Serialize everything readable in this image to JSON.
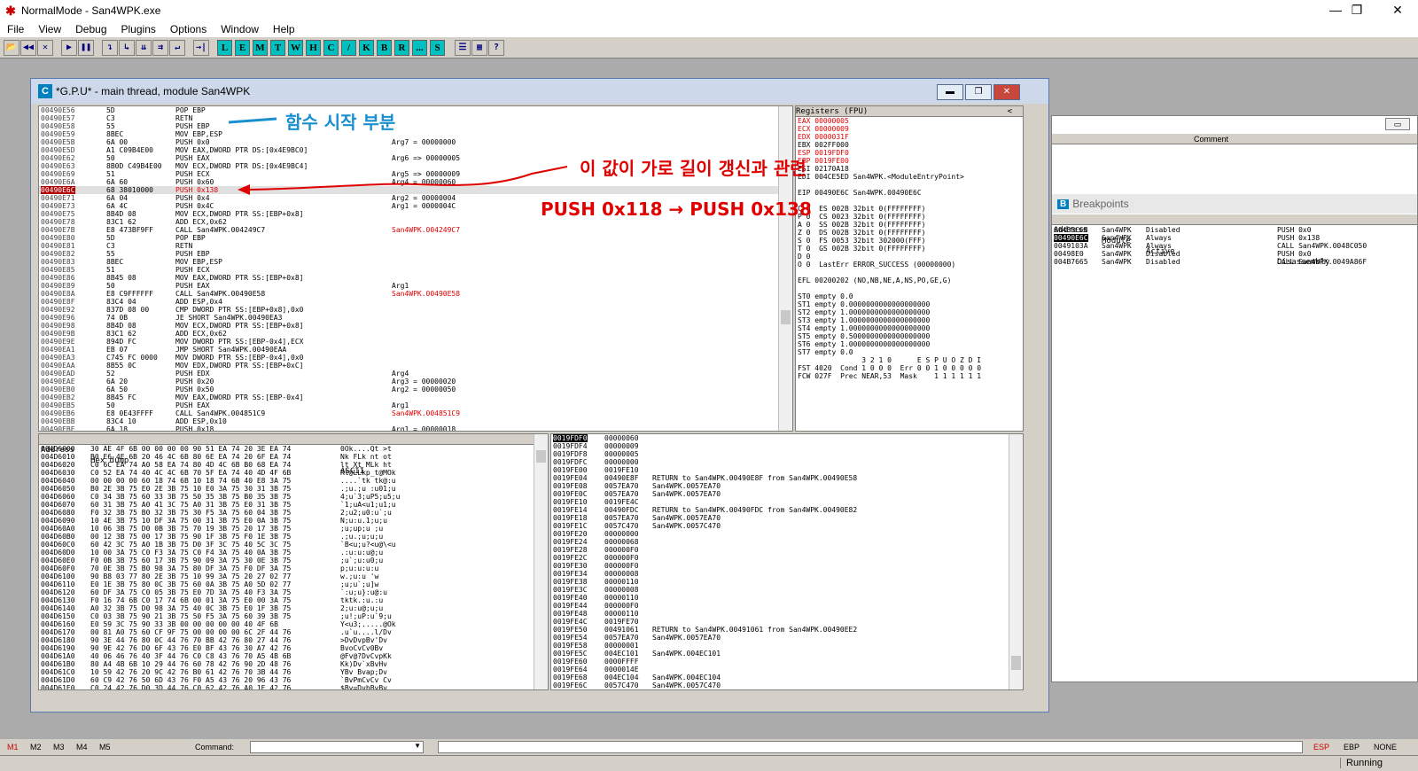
{
  "window": {
    "title": "NormalMode - San4WPK.exe",
    "minimize": "—",
    "maximize": "❐",
    "close": "✕"
  },
  "menu": [
    "File",
    "View",
    "Debug",
    "Plugins",
    "Options",
    "Window",
    "Help"
  ],
  "toolbar": {
    "buttons": [
      "📂",
      "◀◀",
      "✕",
      "▶",
      "❚❚",
      "↴",
      "↳",
      "⇊",
      "⇉",
      "↵",
      "→|"
    ],
    "letters": [
      "L",
      "E",
      "M",
      "T",
      "W",
      "H",
      "C",
      "/",
      "K",
      "B",
      "R",
      "...",
      "S"
    ],
    "extras": [
      "☰",
      "▦",
      "?"
    ]
  },
  "cpu": {
    "title": "*G.P.U* - main thread, module San4WPK",
    "icon": "C"
  },
  "disasm": {
    "rows": [
      {
        "a": "00490E56",
        "h": "5D",
        "c": "POP EBP",
        "m": ""
      },
      {
        "a": "00490E57",
        "h": "C3",
        "c": "RETN",
        "m": ""
      },
      {
        "a": "00490E58",
        "h": "55",
        "c": "PUSH EBP",
        "m": ""
      },
      {
        "a": "00490E59",
        "h": "8BEC",
        "c": "MOV EBP,ESP",
        "m": ""
      },
      {
        "a": "00490E5B",
        "h": "6A 00",
        "c": "PUSH 0x0",
        "m": "Arg7 = 00000000"
      },
      {
        "a": "00490E5D",
        "h": "A1 C09B4E00",
        "c": "MOV EAX,DWORD PTR DS:[0x4E9BC0]",
        "m": ""
      },
      {
        "a": "00490E62",
        "h": "50",
        "c": "PUSH EAX",
        "m": "Arg6 => 00000005"
      },
      {
        "a": "00490E63",
        "h": "8B0D C49B4E00",
        "c": "MOV ECX,DWORD PTR DS:[0x4E9BC4]",
        "m": ""
      },
      {
        "a": "00490E69",
        "h": "51",
        "c": "PUSH ECX",
        "m": "Arg5 => 00000009"
      },
      {
        "a": "00490E6A",
        "h": "6A 60",
        "c": "PUSH 0x60",
        "m": "Arg4 = 00000060"
      },
      {
        "a": "00490E6C",
        "h": "68 38010000",
        "c": "PUSH 0x138",
        "m": "",
        "hl": true
      },
      {
        "a": "00490E71",
        "h": "6A 04",
        "c": "PUSH 0x4",
        "m": "Arg2 = 00000004"
      },
      {
        "a": "00490E73",
        "h": "6A 4C",
        "c": "PUSH 0x4C",
        "m": "Arg1 = 0000004C"
      },
      {
        "a": "00490E75",
        "h": "8B4D 08",
        "c": "MOV ECX,DWORD PTR SS:[EBP+0x8]",
        "m": ""
      },
      {
        "a": "00490E78",
        "h": "83C1 62",
        "c": "ADD ECX,0x62",
        "m": ""
      },
      {
        "a": "00490E7B",
        "h": "E8 473BF9FF",
        "c": "CALL San4WPK.004249C7",
        "m": "San4WPK.004249C7"
      },
      {
        "a": "00490E80",
        "h": "5D",
        "c": "POP EBP",
        "m": ""
      },
      {
        "a": "00490E81",
        "h": "C3",
        "c": "RETN",
        "m": ""
      },
      {
        "a": "00490E82",
        "h": "55",
        "c": "PUSH EBP",
        "m": ""
      },
      {
        "a": "00490E83",
        "h": "8BEC",
        "c": "MOV EBP,ESP",
        "m": ""
      },
      {
        "a": "00490E85",
        "h": "51",
        "c": "PUSH ECX",
        "m": ""
      },
      {
        "a": "00490E86",
        "h": "8B45 08",
        "c": "MOV EAX,DWORD PTR SS:[EBP+0x8]",
        "m": ""
      },
      {
        "a": "00490E89",
        "h": "50",
        "c": "PUSH EAX",
        "m": "Arg1"
      },
      {
        "a": "00490E8A",
        "h": "E8 C9FFFFFF",
        "c": "CALL San4WPK.00490E58",
        "m": "San4WPK.00490E58"
      },
      {
        "a": "00490E8F",
        "h": "83C4 04",
        "c": "ADD ESP,0x4",
        "m": ""
      },
      {
        "a": "00490E92",
        "h": "837D 08 00",
        "c": "CMP DWORD PTR SS:[EBP+0x8],0x0",
        "m": ""
      },
      {
        "a": "00490E96",
        "h": "74 0B",
        "c": "JE SHORT San4WPK.00490EA3",
        "m": ""
      },
      {
        "a": "00490E98",
        "h": "8B4D 08",
        "c": "MOV ECX,DWORD PTR SS:[EBP+0x8]",
        "m": ""
      },
      {
        "a": "00490E9B",
        "h": "83C1 62",
        "c": "ADD ECX,0x62",
        "m": ""
      },
      {
        "a": "00490E9E",
        "h": "894D FC",
        "c": "MOV DWORD PTR SS:[EBP-0x4],ECX",
        "m": ""
      },
      {
        "a": "00490EA1",
        "h": "EB 07",
        "c": "JMP SHORT San4WPK.00490EAA",
        "m": ""
      },
      {
        "a": "00490EA3",
        "h": "C745 FC 0000",
        "c": "MOV DWORD PTR SS:[EBP-0x4],0x0",
        "m": ""
      },
      {
        "a": "00490EAA",
        "h": "8B55 0C",
        "c": "MOV EDX,DWORD PTR SS:[EBP+0xC]",
        "m": ""
      },
      {
        "a": "00490EAD",
        "h": "52",
        "c": "PUSH EDX",
        "m": "Arg4"
      },
      {
        "a": "00490EAE",
        "h": "6A 20",
        "c": "PUSH 0x20",
        "m": "Arg3 = 00000020"
      },
      {
        "a": "00490EB0",
        "h": "6A 50",
        "c": "PUSH 0x50",
        "m": "Arg2 = 00000050"
      },
      {
        "a": "00490EB2",
        "h": "8B45 FC",
        "c": "MOV EAX,DWORD PTR SS:[EBP-0x4]",
        "m": ""
      },
      {
        "a": "00490EB5",
        "h": "50",
        "c": "PUSH EAX",
        "m": "Arg1"
      },
      {
        "a": "00490EB6",
        "h": "E8 0E43FFFF",
        "c": "CALL San4WPK.004851C9",
        "m": "San4WPK.004851C9"
      },
      {
        "a": "00490EBB",
        "h": "83C4 10",
        "c": "ADD ESP,0x10",
        "m": ""
      },
      {
        "a": "00490EBE",
        "h": "6A 18",
        "c": "PUSH 0x18",
        "m": "Arg1 = 00000018"
      }
    ]
  },
  "registers": {
    "title": "Registers (FPU)",
    "rows": [
      {
        "t": "EAX 00000005",
        "red": true
      },
      {
        "t": "ECX 00000009",
        "red": true
      },
      {
        "t": "EDX 0000031F",
        "red": true
      },
      {
        "t": "EBX 002FF000"
      },
      {
        "t": "ESP 0019FDF0",
        "red": true
      },
      {
        "t": "EBP 0019FE00",
        "red": true
      },
      {
        "t": "ESI 02170A18"
      },
      {
        "t": "EDI 004CE5ED San4WPK.<ModuleEntryPoint>"
      },
      {
        "t": ""
      },
      {
        "t": "EIP 00490E6C San4WPK.00490E6C"
      },
      {
        "t": ""
      },
      {
        "t": "C 0  ES 002B 32bit 0(FFFFFFFF)"
      },
      {
        "t": "P 0  CS 0023 32bit 0(FFFFFFFF)"
      },
      {
        "t": "A 0  SS 002B 32bit 0(FFFFFFFF)"
      },
      {
        "t": "Z 0  DS 002B 32bit 0(FFFFFFFF)"
      },
      {
        "t": "S 0  FS 0053 32bit 302000(FFF)"
      },
      {
        "t": "T 0  GS 002B 32bit 0(FFFFFFFF)"
      },
      {
        "t": "D 0"
      },
      {
        "t": "O 0  LastErr ERROR_SUCCESS (00000000)"
      },
      {
        "t": ""
      },
      {
        "t": "EFL 00200202 (NO,NB,NE,A,NS,PO,GE,G)"
      },
      {
        "t": ""
      },
      {
        "t": "ST0 empty 0.0"
      },
      {
        "t": "ST1 empty 0.0000000000000000000"
      },
      {
        "t": "ST2 empty 1.0000000000000000000"
      },
      {
        "t": "ST3 empty 1.0000000000000000000"
      },
      {
        "t": "ST4 empty 1.0000000000000000000"
      },
      {
        "t": "ST5 empty 0.5000000000000000000"
      },
      {
        "t": "ST6 empty 1.0000000000000000000"
      },
      {
        "t": "ST7 empty 0.0"
      },
      {
        "t": "               3 2 1 0      E S P U O Z D I"
      },
      {
        "t": "FST 4020  Cond 1 0 0 0  Err 0 0 1 0 0 0 0 0"
      },
      {
        "t": "FCW 027F  Prec NEAR,53  Mask    1 1 1 1 1 1"
      }
    ]
  },
  "dump": {
    "headers": [
      "Address",
      "Hex dump",
      "ASCII"
    ],
    "rows": [
      {
        "a": "004D6000",
        "h": "30 AE 4F 6B 00 00 00 00 90 51 EA 74 20 3E EA 74",
        "s": "0Ok....Qt >t"
      },
      {
        "a": "004D6010",
        "h": "B0 E6 4E 6B 20 46 4C 6B 80 6E EA 74 20 6F EA 74",
        "s": "Nk FLk nt ot"
      },
      {
        "a": "004D6020",
        "h": "C0 6C EA 74 A0 58 EA 74 80 4D 4C 6B B0 68 EA 74",
        "s": "lt Xt MLk ht"
      },
      {
        "a": "004D6030",
        "h": "C0 52 EA 74 40 4C 4C 6B 70 5F EA 74 40 4D 4F 6B",
        "s": "Rt@LLkp_t@MOk"
      },
      {
        "a": "004D6040",
        "h": "00 00 00 00 60 18 74 6B 10 18 74 6B 40 E8 3A 75",
        "s": "....`tk tk@:u"
      },
      {
        "a": "004D6050",
        "h": "B0 2E 3B 75 E0 2E 3B 75 10 E0 3A 75 30 31 3B 75",
        "s": ".;u.;u :u01;u"
      },
      {
        "a": "004D6060",
        "h": "C0 34 3B 75 60 33 3B 75 50 35 3B 75 B0 35 3B 75",
        "s": "4;u`3;uP5;u5;u"
      },
      {
        "a": "004D6070",
        "h": "60 31 3B 75 A0 41 3C 75 A0 31 3B 75 E0 31 3B 75",
        "s": "`1;uA<u1;u1;u"
      },
      {
        "a": "004D6080",
        "h": "F0 32 3B 75 B0 32 3B 75 30 F5 3A 75 60 04 3B 75",
        "s": "2;u2;u0:u`;u"
      },
      {
        "a": "004D6090",
        "h": "10 4E 3B 75 10 DF 3A 75 00 31 3B 75 E0 0A 3B 75",
        "s": "N;u:u.1;u;u"
      },
      {
        "a": "004D60A0",
        "h": "10 06 3B 75 D0 0B 3B 75 70 19 3B 75 20 17 3B 75",
        "s": ";u;up;u ;u"
      },
      {
        "a": "004D60B0",
        "h": "00 12 3B 75 00 17 3B 75 90 1F 3B 75 F0 1E 3B 75",
        "s": ".;u.;u;u;u"
      },
      {
        "a": "004D60C0",
        "h": "60 42 3C 75 A0 1B 3B 75 D0 3F 3C 75 40 5C 3C 75",
        "s": "`B<u;u?<u@\\<u"
      },
      {
        "a": "004D60D0",
        "h": "10 00 3A 75 C0 F3 3A 75 C0 F4 3A 75 40 0A 3B 75",
        "s": ".:u:u:u@;u"
      },
      {
        "a": "004D60E0",
        "h": "F0 0B 3B 75 60 17 3B 75 90 09 3A 75 30 0E 3B 75",
        "s": ";u`;u:u0;u"
      },
      {
        "a": "004D60F0",
        "h": "70 0E 3B 75 B0 98 3A 75 80 DF 3A 75 F0 DF 3A 75",
        "s": "p;u:u:u:u"
      },
      {
        "a": "004D6100",
        "h": "90 B8 03 77 80 2E 3B 75 10 99 3A 75 20 27 02 77",
        "s": "w.;u:u 'w"
      },
      {
        "a": "004D6110",
        "h": "E0 1E 3B 75 80 0C 3B 75 60 0A 3B 75 A0 5D 02 77",
        "s": ";u;u`;u]w"
      },
      {
        "a": "004D6120",
        "h": "60 DF 3A 75 C0 05 3B 75 E0 7D 3A 75 40 F3 3A 75",
        "s": "`:u;u}:u@:u"
      },
      {
        "a": "004D6130",
        "h": "F0 16 74 6B C0 17 74 6B 00 01 3A 75 E0 00 3A 75",
        "s": "tktk.:u.:u"
      },
      {
        "a": "004D6140",
        "h": "A0 32 3B 75 D0 98 3A 75 40 0C 3B 75 E0 1F 3B 75",
        "s": "2;u:u@;u;u"
      },
      {
        "a": "004D6150",
        "h": "C0 03 3B 75 90 21 3B 75 50 F5 3A 75 60 39 3B 75",
        "s": ";u!;uP:u`9;u"
      },
      {
        "a": "004D6160",
        "h": "E0 59 3C 75 90 33 3B 00 00 00 00 00 40 4F 6B",
        "s": "Y<u3;.....@Ok"
      },
      {
        "a": "004D6170",
        "h": "00 81 A0 75 60 CF 9F 75 00 00 00 00 6C 2F 44 76",
        "s": ".u`u....l/Dv"
      },
      {
        "a": "004D6180",
        "h": "90 3E 44 76 80 0C 44 76 70 BB 42 76 80 27 44 76",
        "s": ">DvDvpBv'Dv"
      },
      {
        "a": "004D6190",
        "h": "90 9E 42 76 D0 6F 43 76 E0 BF 43 76 30 A7 42 76",
        "s": "BvoCvCv0Bv"
      },
      {
        "a": "004D61A0",
        "h": "40 06 46 76 40 3F 44 76 C0 C8 43 76 70 A5 4B 6B",
        "s": "@Fv@?DvCvpKk"
      },
      {
        "a": "004D61B0",
        "h": "80 A4 4B 6B 10 29 44 76 60 78 42 76 90 2D 48 76",
        "s": "Kk)Dv`xBvHv"
      },
      {
        "a": "004D61C0",
        "h": "10 59 42 76 20 9C 42 76 B0 61 42 76 70 3B 44 76",
        "s": "YBv Bvap;Dv"
      },
      {
        "a": "004D61D0",
        "h": "60 C9 42 76 50 6D 43 76 F0 A5 43 76 20 96 43 76",
        "s": "`BvPmCvCv Cv"
      },
      {
        "a": "004D61E0",
        "h": "C0 24 42 76 D0 3D 44 76 C0 62 42 76 A0 1E 42 76",
        "s": "$Bv=DvbBvBv"
      }
    ]
  },
  "stack": {
    "rows": [
      {
        "a": "0019FDF0",
        "v": "00000060",
        "c": "",
        "top": true
      },
      {
        "a": "0019FDF4",
        "v": "00000009",
        "c": ""
      },
      {
        "a": "0019FDF8",
        "v": "00000005",
        "c": ""
      },
      {
        "a": "0019FDFC",
        "v": "00000000",
        "c": ""
      },
      {
        "a": "0019FE00",
        "v": "0019FE10",
        "c": ""
      },
      {
        "a": "0019FE04",
        "v": "00490E8F",
        "c": "RETURN to San4WPK.00490E8F from San4WPK.00490E58"
      },
      {
        "a": "0019FE08",
        "v": "0057EA70",
        "c": "San4WPK.0057EA70"
      },
      {
        "a": "0019FE0C",
        "v": "0057EA70",
        "c": "San4WPK.0057EA70"
      },
      {
        "a": "0019FE10",
        "v": "0019FE4C",
        "c": ""
      },
      {
        "a": "0019FE14",
        "v": "00490FDC",
        "c": "RETURN to San4WPK.00490FDC from San4WPK.00490E82"
      },
      {
        "a": "0019FE18",
        "v": "0057EA70",
        "c": "San4WPK.0057EA70"
      },
      {
        "a": "0019FE1C",
        "v": "0057C470",
        "c": "San4WPK.0057C470"
      },
      {
        "a": "0019FE20",
        "v": "00000000",
        "c": ""
      },
      {
        "a": "0019FE24",
        "v": "00000068",
        "c": ""
      },
      {
        "a": "0019FE28",
        "v": "000000F0",
        "c": ""
      },
      {
        "a": "0019FE2C",
        "v": "000000F0",
        "c": ""
      },
      {
        "a": "0019FE30",
        "v": "000000F0",
        "c": ""
      },
      {
        "a": "0019FE34",
        "v": "00000008",
        "c": ""
      },
      {
        "a": "0019FE38",
        "v": "00000110",
        "c": ""
      },
      {
        "a": "0019FE3C",
        "v": "00000008",
        "c": ""
      },
      {
        "a": "0019FE40",
        "v": "00000110",
        "c": ""
      },
      {
        "a": "0019FE44",
        "v": "000000F0",
        "c": ""
      },
      {
        "a": "0019FE48",
        "v": "00000110",
        "c": ""
      },
      {
        "a": "0019FE4C",
        "v": "0019FE70",
        "c": ""
      },
      {
        "a": "0019FE50",
        "v": "00491061",
        "c": "RETURN to San4WPK.00491061 from San4WPK.00490EE2"
      },
      {
        "a": "0019FE54",
        "v": "0057EA70",
        "c": "San4WPK.0057EA70"
      },
      {
        "a": "0019FE58",
        "v": "00000001",
        "c": ""
      },
      {
        "a": "0019FE5C",
        "v": "004EC101",
        "c": "San4WPK.004EC101"
      },
      {
        "a": "0019FE60",
        "v": "0000FFFF",
        "c": ""
      },
      {
        "a": "0019FE64",
        "v": "0000014E",
        "c": ""
      },
      {
        "a": "0019FE68",
        "v": "004EC104",
        "c": "San4WPK.004EC104"
      },
      {
        "a": "0019FE6C",
        "v": "0057C470",
        "c": "San4WPK.0057C470"
      },
      {
        "a": "0019FE70",
        "v": "0019FE94",
        "c": ""
      }
    ]
  },
  "annotations": {
    "func_start": "함수 시작 부분",
    "value_note": "이 값이 가로 길이 갱신과 관련",
    "push_change": "PUSH 0x118 → PUSH 0x138"
  },
  "side": {
    "comment_header": "Comment",
    "bp_title": "Breakpoints",
    "bp_headers": [
      "Address",
      "Module",
      "Active",
      "Disassembly"
    ],
    "bp_rows": [
      {
        "a": "0048BC6B",
        "m": "San4WPK",
        "s": "Disabled",
        "d": "PUSH 0x0"
      },
      {
        "a": "00490E6C",
        "m": "San4WPK",
        "s": "Always",
        "d": "PUSH 0x138",
        "sel": true
      },
      {
        "a": "0049103A",
        "m": "San4WPK",
        "s": "Always",
        "d": "CALL San4WPK.0048C050"
      },
      {
        "a": "00498E0",
        "m": "San4WPK",
        "s": "Disabled",
        "d": "PUSH 0x0"
      },
      {
        "a": "004B7665",
        "m": "San4WPK",
        "s": "Disabled",
        "d": "CALL San4WPK.0049A86F"
      }
    ]
  },
  "bottom": {
    "tabs": [
      "M1",
      "M2",
      "M3",
      "M4",
      "M5"
    ],
    "command_label": "Command:",
    "esp": "ESP",
    "ebp": "EBP",
    "none": "NONE",
    "status": "Running"
  },
  "colors": {
    "highlight": "#e00000",
    "reg_changed": "#e00000"
  }
}
